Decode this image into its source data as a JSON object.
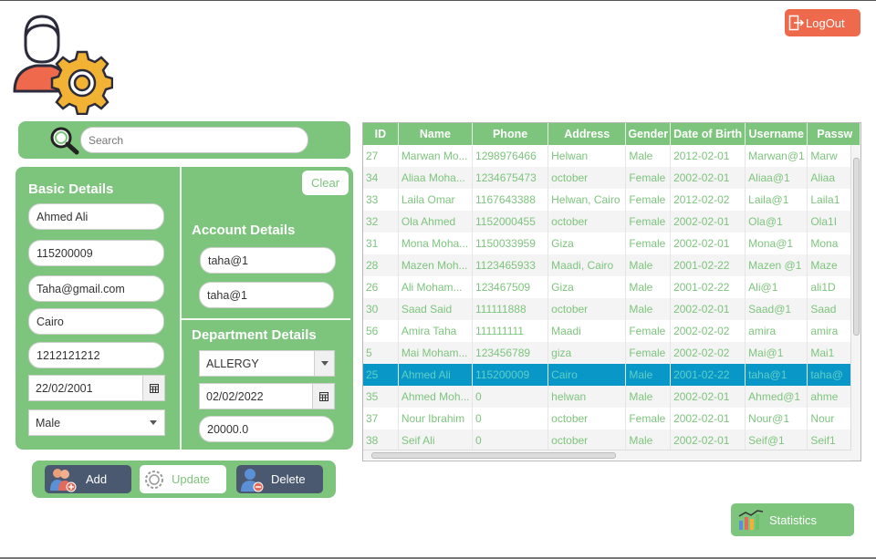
{
  "header": {
    "logout_label": "LogOut"
  },
  "search": {
    "placeholder": "Search"
  },
  "basic": {
    "title": "Basic Details",
    "name": "Ahmed Ali",
    "phone": "115200009",
    "email": "Taha@gmail.com",
    "address": "Cairo",
    "national_id": "1212121212",
    "birth_date": "22/02/2001",
    "gender": "Male"
  },
  "account": {
    "title": "Account Details",
    "username": "taha@1",
    "password": "taha@1",
    "clear_label": "Clear"
  },
  "department": {
    "title": "Department Details",
    "name": "ALLERGY",
    "hire_date": "02/02/2022",
    "salary": "20000.0"
  },
  "actions": {
    "add": "Add",
    "update": "Update",
    "delete": "Delete"
  },
  "statistics_label": "Statistics",
  "table": {
    "columns": [
      "ID",
      "Name",
      "Phone",
      "Address",
      "Gender",
      "Date of Birth",
      "Username",
      "Passw"
    ],
    "rows": [
      [
        "27",
        "Marwan Mo...",
        "1298976466",
        "Helwan",
        "Male",
        "2012-02-01",
        "Marwan@1",
        "Marw"
      ],
      [
        "34",
        "Aliaa Moha...",
        "1234675473",
        "october",
        "Female",
        "2002-02-01",
        "Aliaa@1",
        "Aliaa"
      ],
      [
        "33",
        "Laila Omar",
        "1167643388",
        "Helwan, Cairo",
        "Female",
        "2012-02-02",
        "Laila@1",
        "Laila1"
      ],
      [
        "32",
        "Ola Ahmed",
        "1152000455",
        "october",
        "Female",
        "2002-02-01",
        "Ola@1",
        "Ola1I"
      ],
      [
        "31",
        "Mona Moha...",
        "1150033959",
        "Giza",
        "Female",
        "2002-02-01",
        "Mona@1",
        "Mona"
      ],
      [
        "28",
        "Mazen Moh...",
        "1123465933",
        "Maadi, Cairo",
        "Male",
        "2001-02-22",
        "Mazen @1",
        "Maze"
      ],
      [
        "26",
        "Ali Moham...",
        "123467509",
        "Giza",
        "Male",
        "2001-02-22",
        "Ali@1",
        "ali1D"
      ],
      [
        "30",
        "Saad Said",
        "111111888",
        "october",
        "Male",
        "2002-02-01",
        "Saad@1",
        "Saad"
      ],
      [
        "56",
        "Amira Taha",
        "111111111",
        "Maadi",
        "Female",
        "2002-02-02",
        "amira",
        "amira"
      ],
      [
        "5",
        "Mai Moham...",
        "123456789",
        "giza",
        "Female",
        "2002-02-02",
        "Mai@1",
        "Mai1"
      ],
      [
        "25",
        "Ahmed Ali",
        "115200009",
        "Cairo",
        "Male",
        "2001-02-22",
        "taha@1",
        "taha@"
      ],
      [
        "35",
        "Ahmed Moh...",
        "0",
        "helwan",
        "Male",
        "2002-02-01",
        "Ahmed@1",
        "ahme"
      ],
      [
        "37",
        "Nour Ibrahim",
        "0",
        "october",
        "Female",
        "2002-02-01",
        "Nour@1",
        "Nour"
      ],
      [
        "38",
        "Seif Ali",
        "0",
        "october",
        "Male",
        "2002-02-01",
        "Seif@1",
        "Seif1"
      ]
    ],
    "selected_index": 10
  }
}
